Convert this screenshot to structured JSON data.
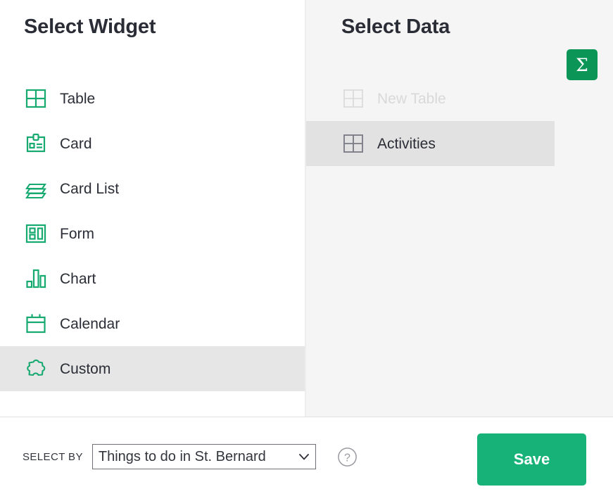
{
  "dialog": {
    "widget_panel": {
      "title": "Select Widget",
      "items": [
        {
          "label": "Table",
          "icon": "table-grid-icon",
          "selected": false
        },
        {
          "label": "Card",
          "icon": "id-card-icon",
          "selected": false
        },
        {
          "label": "Card List",
          "icon": "card-stack-icon",
          "selected": false
        },
        {
          "label": "Form",
          "icon": "form-layout-icon",
          "selected": false
        },
        {
          "label": "Chart",
          "icon": "bar-chart-icon",
          "selected": false
        },
        {
          "label": "Calendar",
          "icon": "calendar-icon",
          "selected": false
        },
        {
          "label": "Custom",
          "icon": "puzzle-piece-icon",
          "selected": true
        }
      ]
    },
    "data_panel": {
      "title": "Select Data",
      "items": [
        {
          "label": "New Table",
          "icon": "table-grid-icon",
          "selected": false,
          "disabled": true
        },
        {
          "label": "Activities",
          "icon": "table-grid-icon",
          "selected": true,
          "disabled": false
        }
      ],
      "summary_button": {
        "label": "Σ",
        "icon": "sigma-icon"
      }
    },
    "footer": {
      "select_by_label": "SELECT BY",
      "select_by_value": "Things to do in St. Bernard",
      "select_by_icon": "chevron-down-icon",
      "help_icon": "question-mark-circle-icon",
      "save_label": "Save"
    }
  },
  "colors": {
    "widget_icon_green": "#16a970",
    "save_green": "#16b278",
    "sigma_green": "#0b9557",
    "panel_background": "#f5f5f5",
    "row_selected": "#e6e6e6",
    "text_primary": "#2b2d36",
    "text_disabled": "#d9d9d9",
    "data_icon_gray": "#7a7a85"
  }
}
